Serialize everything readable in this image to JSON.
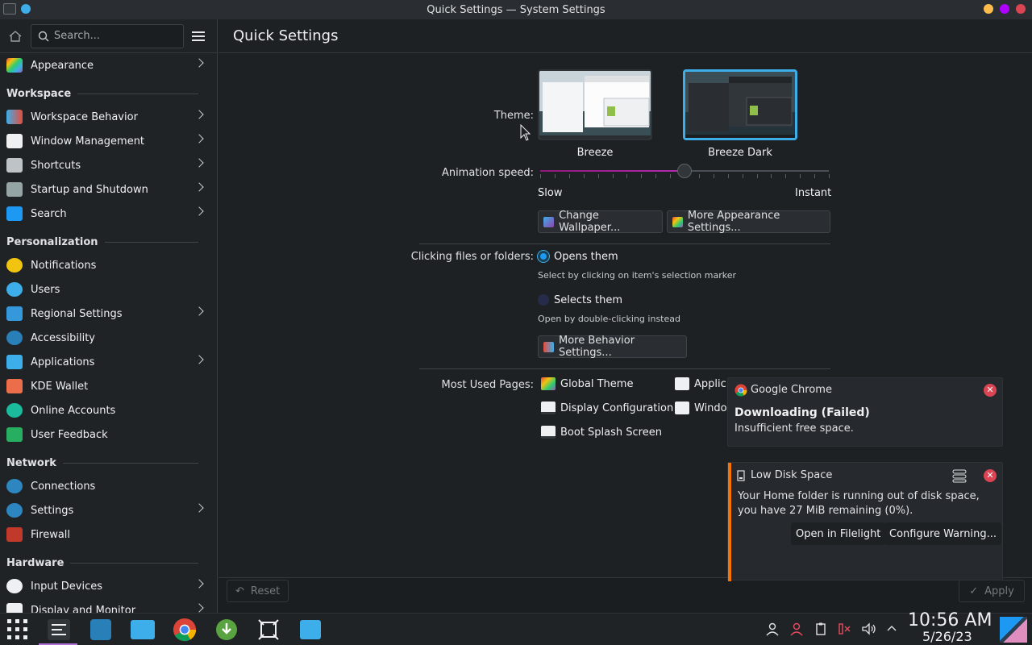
{
  "window": {
    "title": "Quick Settings — System Settings"
  },
  "sidebar": {
    "search_placeholder": "Search...",
    "top_item": {
      "label": "Appearance"
    },
    "sections": [
      {
        "title": "Workspace",
        "items": [
          {
            "label": "Workspace Behavior",
            "icon": "workspace-icon",
            "chevron": true
          },
          {
            "label": "Window Management",
            "icon": "window-icon",
            "chevron": true
          },
          {
            "label": "Shortcuts",
            "icon": "keyboard-icon",
            "chevron": true
          },
          {
            "label": "Startup and Shutdown",
            "icon": "startup-icon",
            "chevron": true
          },
          {
            "label": "Search",
            "icon": "search-icon",
            "chevron": true
          }
        ]
      },
      {
        "title": "Personalization",
        "items": [
          {
            "label": "Notifications",
            "icon": "bell-icon",
            "chevron": false
          },
          {
            "label": "Users",
            "icon": "users-icon",
            "chevron": false
          },
          {
            "label": "Regional Settings",
            "icon": "regional-icon",
            "chevron": true
          },
          {
            "label": "Accessibility",
            "icon": "accessibility-icon",
            "chevron": false
          },
          {
            "label": "Applications",
            "icon": "applications-icon",
            "chevron": true
          },
          {
            "label": "KDE Wallet",
            "icon": "wallet-icon",
            "chevron": false
          },
          {
            "label": "Online Accounts",
            "icon": "online-accounts-icon",
            "chevron": false
          },
          {
            "label": "User Feedback",
            "icon": "feedback-icon",
            "chevron": false
          }
        ]
      },
      {
        "title": "Network",
        "items": [
          {
            "label": "Connections",
            "icon": "globe-icon",
            "chevron": false
          },
          {
            "label": "Settings",
            "icon": "globe-settings-icon",
            "chevron": true
          },
          {
            "label": "Firewall",
            "icon": "firewall-icon",
            "chevron": false
          }
        ]
      },
      {
        "title": "Hardware",
        "items": [
          {
            "label": "Input Devices",
            "icon": "mouse-icon",
            "chevron": true
          },
          {
            "label": "Display and Monitor",
            "icon": "display-icon",
            "chevron": true
          }
        ]
      }
    ]
  },
  "main": {
    "page_title": "Quick Settings",
    "theme_label": "Theme:",
    "themes": [
      {
        "name": "Breeze",
        "selected": false
      },
      {
        "name": "Breeze Dark",
        "selected": true
      }
    ],
    "animation_label": "Animation speed:",
    "animation_slow": "Slow",
    "animation_instant": "Instant",
    "animation_value": 0.5,
    "change_wallpaper": "Change Wallpaper...",
    "more_appearance": "More Appearance Settings...",
    "clicking_label": "Clicking files or folders:",
    "opens_them": "Opens them",
    "opens_sub": "Select by clicking on item's selection marker",
    "selects_them": "Selects them",
    "selects_sub": "Open by double-clicking instead",
    "more_behavior": "More Behavior Settings...",
    "most_used_label": "Most Used Pages:",
    "most_used": [
      {
        "label": "Global Theme",
        "icon": "global-theme-icon"
      },
      {
        "label": "Display Configuration",
        "icon": "display-icon"
      },
      {
        "label": "Boot Splash Screen",
        "icon": "splash-icon"
      },
      {
        "label": "Applic",
        "icon": "application-style-icon"
      },
      {
        "label": "Windo",
        "icon": "window-icon"
      }
    ]
  },
  "bottom": {
    "reset": "Reset",
    "apply": "Apply"
  },
  "notifications": [
    {
      "app": "Google Chrome",
      "title": "Downloading (Failed)",
      "body": "Insufficient free space."
    },
    {
      "app": "Low Disk Space",
      "body_line1": "Your Home folder is running out of disk space,",
      "body_line2": "you have 27 MiB remaining (0%).",
      "btn1": "Open in Filelight",
      "btn2": "Configure Warning..."
    }
  ],
  "taskbar": {
    "time": "10:56 AM",
    "date": "5/26/23"
  },
  "colors": {
    "accent": "#3daee9",
    "close": "#da4453",
    "warning": "#f67400"
  }
}
